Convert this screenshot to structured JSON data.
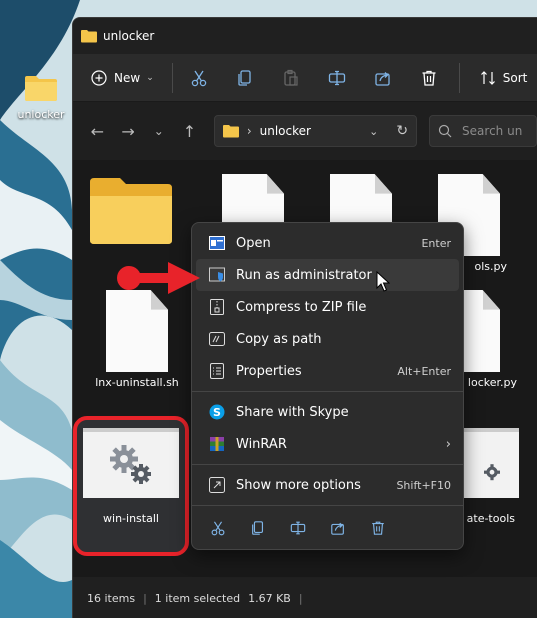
{
  "desktop": {
    "icon_label": "unlocker",
    "icon": "folder-icon"
  },
  "window": {
    "title": "unlocker",
    "title_icon": "folder-icon"
  },
  "toolbar": {
    "new_label": "New",
    "sort_label": "Sort",
    "buttons": [
      "cut-icon",
      "copy-icon",
      "paste-icon",
      "rename-icon",
      "share-icon",
      "delete-icon"
    ]
  },
  "address": {
    "breadcrumb_sep": "›",
    "path": "unlocker",
    "search_placeholder": "Search un"
  },
  "files": [
    {
      "name": "",
      "type": "folder"
    },
    {
      "name": "",
      "type": "document"
    },
    {
      "name": "",
      "type": "document"
    },
    {
      "name": "ols.py",
      "type": "document"
    },
    {
      "name": "lnx-uninstall.sh",
      "type": "document"
    },
    {
      "name": "locker.py",
      "type": "document"
    },
    {
      "name": "win-install",
      "type": "executable",
      "selected": true
    },
    {
      "name": "ate-tools",
      "type": "executable"
    }
  ],
  "status": {
    "item_count": "16 items",
    "selection": "1 item selected",
    "size": "1.67 KB"
  },
  "context_menu": {
    "items": [
      {
        "label": "Open",
        "shortcut": "Enter",
        "icon": "open-icon"
      },
      {
        "label": "Run as administrator",
        "shortcut": "",
        "icon": "shield-icon",
        "hover": true
      },
      {
        "label": "Compress to ZIP file",
        "shortcut": "",
        "icon": "zip-icon"
      },
      {
        "label": "Copy as path",
        "shortcut": "",
        "icon": "copy-path-icon"
      },
      {
        "label": "Properties",
        "shortcut": "Alt+Enter",
        "icon": "properties-icon"
      },
      {
        "label": "Share with Skype",
        "shortcut": "",
        "icon": "skype-icon"
      },
      {
        "label": "WinRAR",
        "shortcut": "",
        "icon": "winrar-icon",
        "submenu": true
      },
      {
        "label": "Show more options",
        "shortcut": "Shift+F10",
        "icon": "more-options-icon"
      }
    ],
    "bottom_actions": [
      "cut-icon",
      "copy-icon",
      "rename-icon",
      "share-icon",
      "delete-icon"
    ]
  },
  "colors": {
    "accent": "#e8232a",
    "window_bg": "#1f1f1f",
    "menu_bg": "#2c2c2c",
    "folder": "#f4c54a"
  }
}
